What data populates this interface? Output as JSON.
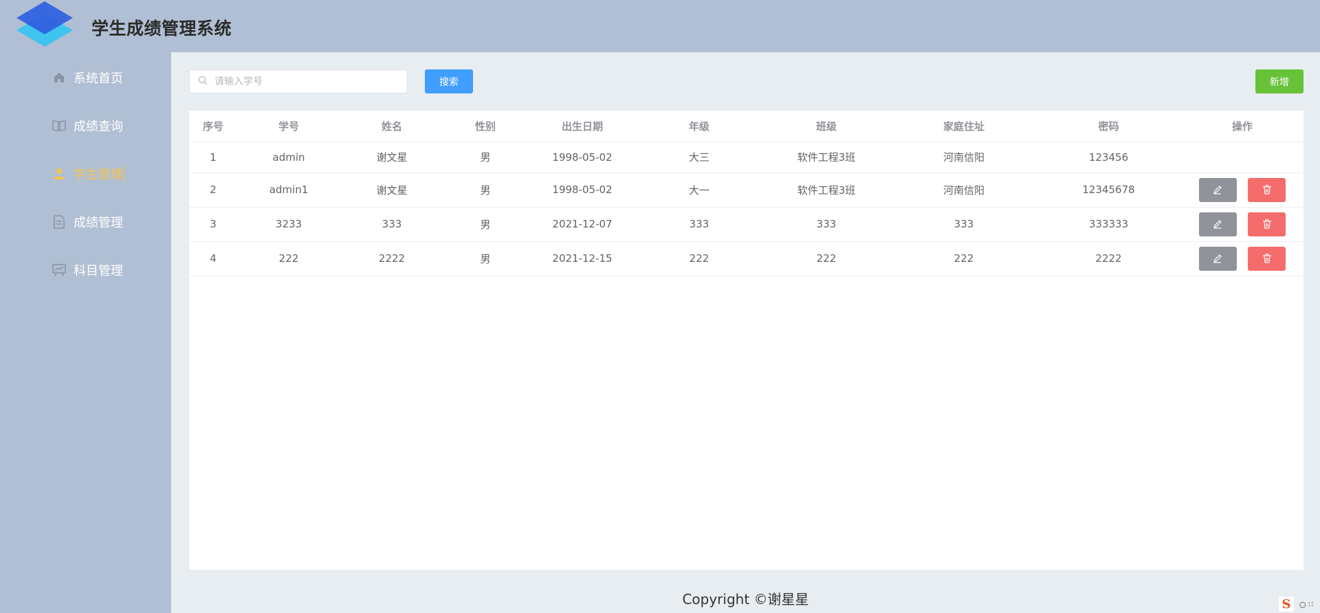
{
  "header": {
    "title": "学生成绩管理系统"
  },
  "sidebar": {
    "items": [
      {
        "label": "系统首页",
        "icon": "home-icon",
        "active": false
      },
      {
        "label": "成绩查询",
        "icon": "book-icon",
        "active": false
      },
      {
        "label": "学生管理",
        "icon": "user-icon",
        "active": true
      },
      {
        "label": "成绩管理",
        "icon": "document-icon",
        "active": false
      },
      {
        "label": "科目管理",
        "icon": "chart-board-icon",
        "active": false
      }
    ]
  },
  "toolbar": {
    "search_placeholder": "请输入学号",
    "search_value": "",
    "search_label": "搜索",
    "add_label": "新增"
  },
  "table": {
    "columns": [
      "序号",
      "学号",
      "姓名",
      "性别",
      "出生日期",
      "年级",
      "班级",
      "家庭住址",
      "密码",
      "操作"
    ],
    "rows": [
      {
        "index": "1",
        "student_id": "admin",
        "name": "谢文星",
        "gender": "男",
        "birthday": "1998-05-02",
        "grade": "大三",
        "class": "软件工程3班",
        "address": "河南信阳",
        "password": "123456",
        "has_actions": false
      },
      {
        "index": "2",
        "student_id": "admin1",
        "name": "谢文星",
        "gender": "男",
        "birthday": "1998-05-02",
        "grade": "大一",
        "class": "软件工程3班",
        "address": "河南信阳",
        "password": "12345678",
        "has_actions": true
      },
      {
        "index": "3",
        "student_id": "3233",
        "name": "333",
        "gender": "男",
        "birthday": "2021-12-07",
        "grade": "333",
        "class": "333",
        "address": "333",
        "password": "333333",
        "has_actions": true
      },
      {
        "index": "4",
        "student_id": "222",
        "name": "2222",
        "gender": "男",
        "birthday": "2021-12-15",
        "grade": "222",
        "class": "222",
        "address": "222",
        "password": "2222",
        "has_actions": true
      }
    ]
  },
  "footer": {
    "copyright": "Copyright ©谢星星"
  },
  "ime": {
    "logo": "S",
    "extra": "○ ∷"
  },
  "colors": {
    "header_bg": "#b0bfd3",
    "main_bg": "#e8edf2",
    "active": "#f5c451",
    "primary": "#409eff",
    "success": "#67c23a",
    "info": "#909399",
    "danger": "#f56c6c"
  }
}
